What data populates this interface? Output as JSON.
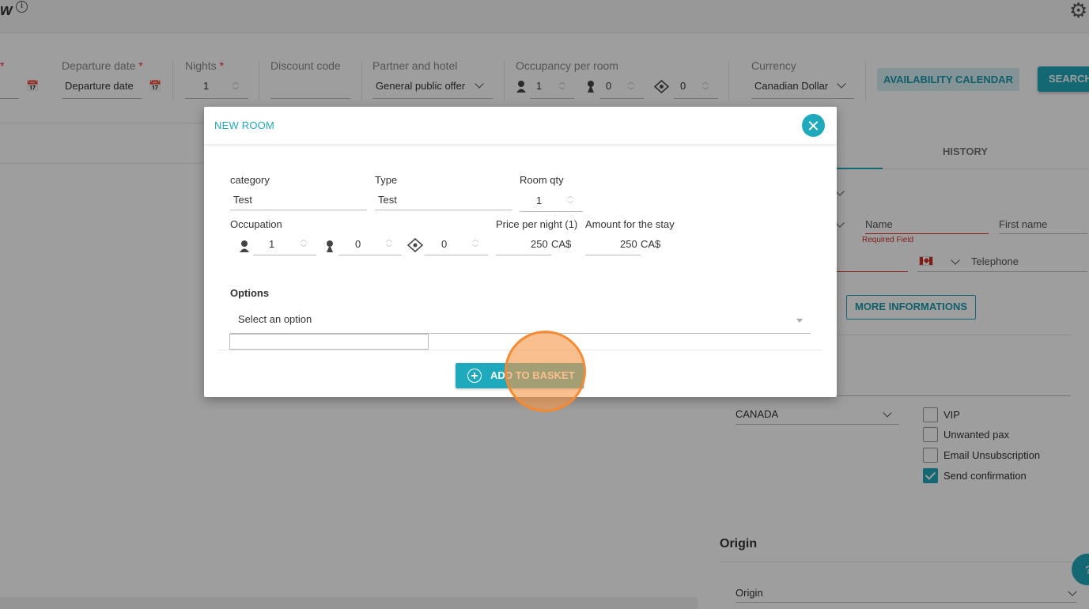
{
  "topbar": {
    "app_title": "w",
    "info_glyph": "i",
    "icons": [
      "info-icon",
      "gear-icon"
    ]
  },
  "search": {
    "arrival_required": "*",
    "departure_label": "Departure date",
    "departure_placeholder": "Departure date",
    "nights_label": "Nights",
    "nights_value": "1",
    "discount_label": "Discount code",
    "partner_label": "Partner and hotel",
    "partner_value": "General public offer",
    "occupancy_label": "Occupancy per room",
    "occupancy_adults": "1",
    "occupancy_children": "0",
    "occupancy_babies": "0",
    "currency_label": "Currency",
    "currency_value": "Canadian Dollar",
    "required_mark": "*",
    "availability_button": "AVAILABILITY CALENDAR",
    "search_button": "SEARCH"
  },
  "customer": {
    "tab_history": "HISTORY",
    "name_placeholder": "Name",
    "name_error": "Required Field",
    "first_name_placeholder": "First name",
    "telephone_placeholder": "Telephone",
    "more_info_button": "MORE INFORMATIONS",
    "country_value": "CANADA",
    "checkboxes": [
      {
        "label": "VIP",
        "checked": false
      },
      {
        "label": "Unwanted pax",
        "checked": false
      },
      {
        "label": "Email Unsubscription",
        "checked": false
      },
      {
        "label": "Send confirmation",
        "checked": true
      }
    ]
  },
  "origin": {
    "title": "Origin",
    "select_placeholder": "Origin",
    "help_glyph": "?"
  },
  "modal": {
    "title": "NEW ROOM",
    "category_label": "category",
    "category_value": "Test",
    "type_label": "Type",
    "type_value": "Test",
    "room_qty_label": "Room qty",
    "room_qty_value": "1",
    "occupation_label": "Occupation",
    "adults_value": "1",
    "children_value": "0",
    "babies_value": "0",
    "price_label": "Price per night (1)",
    "price_value": "250",
    "price_currency": "CA$",
    "amount_label": "Amount for the stay",
    "amount_value": "250",
    "amount_currency": "CA$",
    "options_label": "Options",
    "options_placeholder": "Select an option",
    "add_button": "ADD TO BASKET"
  },
  "colors": {
    "accent": "#1fa9bc",
    "error": "#d32f2f",
    "click_marker": "#f59a4a"
  }
}
